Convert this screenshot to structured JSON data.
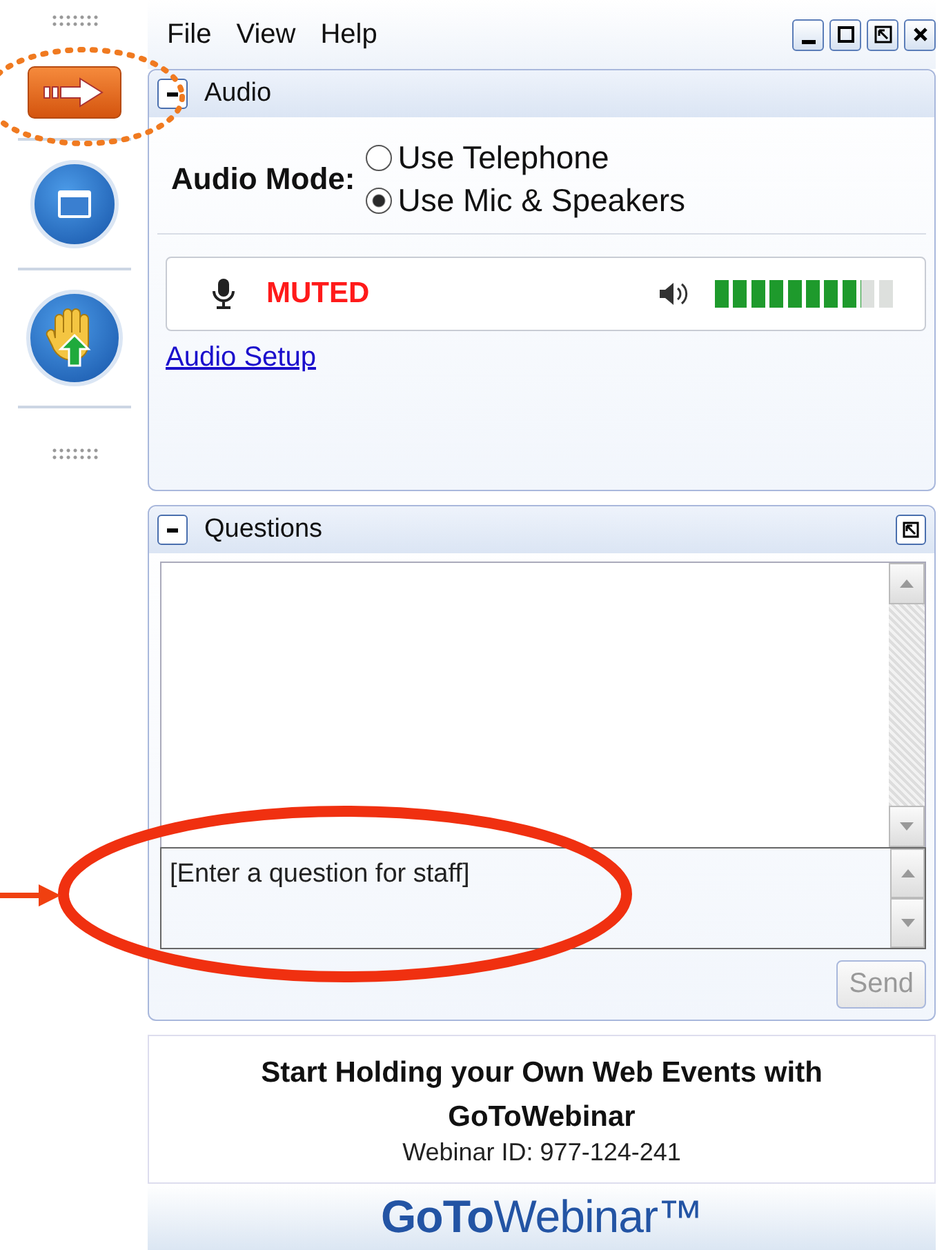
{
  "menu": [
    "File",
    "View",
    "Help"
  ],
  "audio": {
    "title": "Audio",
    "mode_label": "Audio Mode:",
    "options": [
      {
        "label": "Use Telephone",
        "selected": false
      },
      {
        "label": "Use Mic & Speakers",
        "selected": true
      }
    ],
    "status": "MUTED",
    "speaker": {
      "level": 0.8
    },
    "setup_link": "Audio Setup"
  },
  "questions": {
    "title": "Questions",
    "placeholder": "[Enter a question for staff]",
    "send": {
      "label": "Send",
      "disabled": true
    }
  },
  "promo": {
    "headline": "Start Holding your Own Web Events with GoToWebinar",
    "webinar_id": "Webinar ID: 977-124-241"
  },
  "logo": "**GoTo**Webinar™"
}
